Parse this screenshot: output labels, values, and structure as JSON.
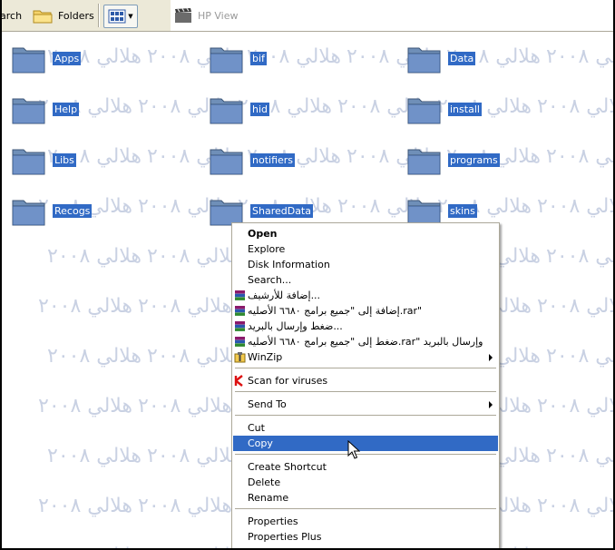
{
  "toolbar": {
    "search_label": "arch",
    "folders_label": "Folders",
    "hpview_label": "HP View"
  },
  "watermark": {
    "text": "هلالي ٢٠٠٨"
  },
  "folders": [
    {
      "label": "Apps"
    },
    {
      "label": "bif"
    },
    {
      "label": "Data"
    },
    {
      "label": "Help"
    },
    {
      "label": "hid"
    },
    {
      "label": "install"
    },
    {
      "label": "Libs"
    },
    {
      "label": "notifiers"
    },
    {
      "label": "programs"
    },
    {
      "label": "Recogs"
    },
    {
      "label": "SharedData"
    },
    {
      "label": "skins"
    }
  ],
  "context_menu": {
    "items": [
      {
        "label": "Open"
      },
      {
        "label": "Explore"
      },
      {
        "label": "Disk Information"
      },
      {
        "label": "Search..."
      },
      {
        "label": "إضافة للأرشيف..."
      },
      {
        "label": "إضافة إلى \"جميع برامج ٦٦٨٠ الأصليه.rar\""
      },
      {
        "label": "ضغط وإرسال بالبريد..."
      },
      {
        "label": "ضغط إلى \"جميع برامج ٦٦٨٠ الأصليه.rar\" وإرسال بالبريد"
      },
      {
        "label": "WinZip"
      },
      {
        "label": "Scan for viruses"
      },
      {
        "label": "Send To"
      },
      {
        "label": "Cut"
      },
      {
        "label": "Copy"
      },
      {
        "label": "Create Shortcut"
      },
      {
        "label": "Delete"
      },
      {
        "label": "Rename"
      },
      {
        "label": "Properties"
      },
      {
        "label": "Properties Plus"
      }
    ],
    "selected": "Copy"
  },
  "colors": {
    "selection": "#316ac5",
    "toolbar_bg": "#ece9d8",
    "watermark": "#c9d1e3"
  }
}
